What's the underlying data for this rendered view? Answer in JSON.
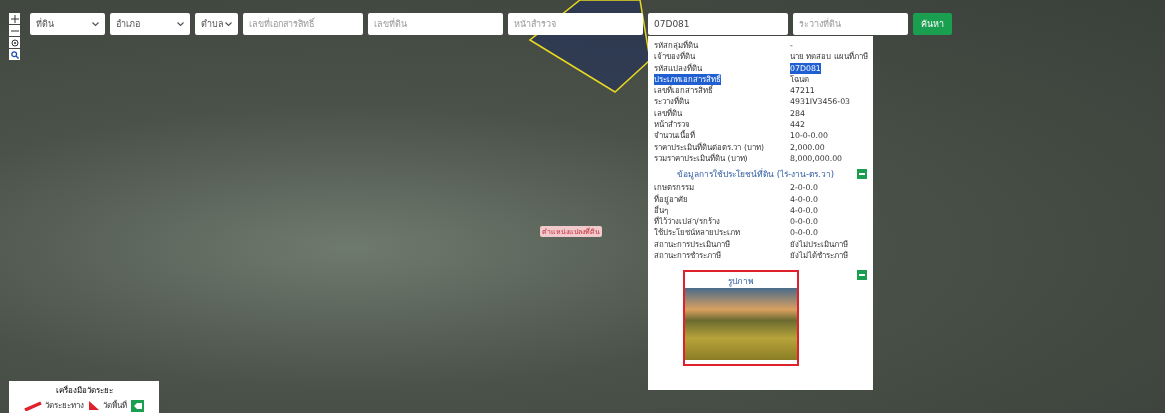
{
  "search_bar": {
    "selects": [
      {
        "value": "ที่ดิน"
      },
      {
        "value": "อำเภอ"
      },
      {
        "value": "ตำบล"
      }
    ],
    "fields": [
      {
        "placeholder": "เลขที่เอกสารสิทธิ์"
      },
      {
        "placeholder": "เลขที่ดิน"
      },
      {
        "placeholder": "หน้าสำรวจ"
      },
      {
        "value": "07D081"
      },
      {
        "placeholder": "ระวางที่ดิน"
      }
    ],
    "button": "ค้นหา"
  },
  "map_label": "ตำแหน่งแปลงที่ดิน",
  "popup": {
    "rows": [
      {
        "label": "รหัสกลุ่มที่ดิน",
        "value": "-",
        "selected": false,
        "value_selected": false
      },
      {
        "label": "เจ้าของที่ดิน",
        "value": "นาย ทดสอบ แผนที่ภาษี",
        "selected": false,
        "value_selected": false
      },
      {
        "label": "รหัสแปลงที่ดิน",
        "value": "07D081",
        "selected": false,
        "value_selected": true
      },
      {
        "label": "ประเภทเอกสารสิทธิ์",
        "value": "โฉนด",
        "selected": true,
        "value_selected": false
      },
      {
        "label": "เลขที่เอกสารสิทธิ์",
        "value": "47211",
        "selected": false,
        "value_selected": false
      },
      {
        "label": "ระวางที่ดิน",
        "value": "4931IV3456-03",
        "selected": false,
        "value_selected": false
      },
      {
        "label": "เลขที่ดิน",
        "value": "284",
        "selected": false,
        "value_selected": false
      },
      {
        "label": "หน้าสำรวจ",
        "value": "442",
        "selected": false,
        "value_selected": false
      },
      {
        "label": "จำนวนเนื้อที่",
        "value": "10-0-0.00",
        "selected": false,
        "value_selected": false
      },
      {
        "label": "ราคาประเมินที่ดินต่อตร.วา (บาท)",
        "value": "2,000.00",
        "selected": false,
        "value_selected": false
      },
      {
        "label": "รวมราคาประเมินที่ดิน (บาท)",
        "value": "8,000,000.00",
        "selected": false,
        "value_selected": false
      }
    ],
    "usage_title": "ข้อมูลการใช้ประโยชน์ที่ดิน (ไร่-งาน-ตร.วา)",
    "usage_rows": [
      {
        "label": "เกษตรกรรม",
        "value": "2-0-0.0"
      },
      {
        "label": "ที่อยู่อาศัย",
        "value": "4-0-0.0"
      },
      {
        "label": "อื่นๆ",
        "value": "4-0-0.0"
      },
      {
        "label": "ที่ไว้ว่างเปล่า/รกร้าง",
        "value": "0-0-0.0"
      },
      {
        "label": "ใช้ประโยชน์หลายประเภท",
        "value": "0-0-0.0"
      },
      {
        "label": "สถานะการประเมินภาษี",
        "value": "ยังไม่ประเมินภาษี"
      },
      {
        "label": "สถานะการชำระภาษี",
        "value": "ยังไม่ได้ชำระภาษี"
      }
    ],
    "photo_title": "รูปภาพ"
  },
  "tools": {
    "title": "เครื่องมือวัดระยะ",
    "items": [
      {
        "kind": "distance",
        "label": "วัดระยะทาง"
      },
      {
        "kind": "area",
        "label": "วัดพื้นที่"
      }
    ]
  }
}
